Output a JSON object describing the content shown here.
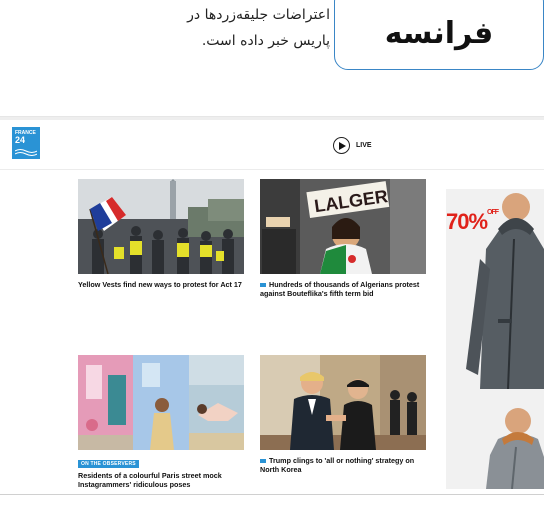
{
  "caption": {
    "title": "فرانسه",
    "text": "اعتراضات جلیقه‌زردها در پاریس خبر داده است."
  },
  "site": {
    "logo_line1": "FRANCE",
    "logo_line2": "24",
    "live_label": "LIVE",
    "brand_color": "#2a93d5"
  },
  "articles": [
    {
      "title": "Yellow Vests find new ways to protest for Act 17",
      "kicker": ""
    },
    {
      "title": "Hundreds of thousands of Algerians protest against Bouteflika's fifth term bid",
      "kicker": ""
    },
    {
      "title": "Residents of a colourful Paris street mock Instagrammers' ridiculous poses",
      "kicker": "ON THE OBSERVERS"
    },
    {
      "title": "Trump clings to 'all or nothing' strategy on North Korea",
      "kicker": ""
    }
  ],
  "images": {
    "sign_text": "LALGER"
  },
  "ad": {
    "sale_text": "70%",
    "sale_suffix": "OFF",
    "sale_color": "#e0221a"
  }
}
